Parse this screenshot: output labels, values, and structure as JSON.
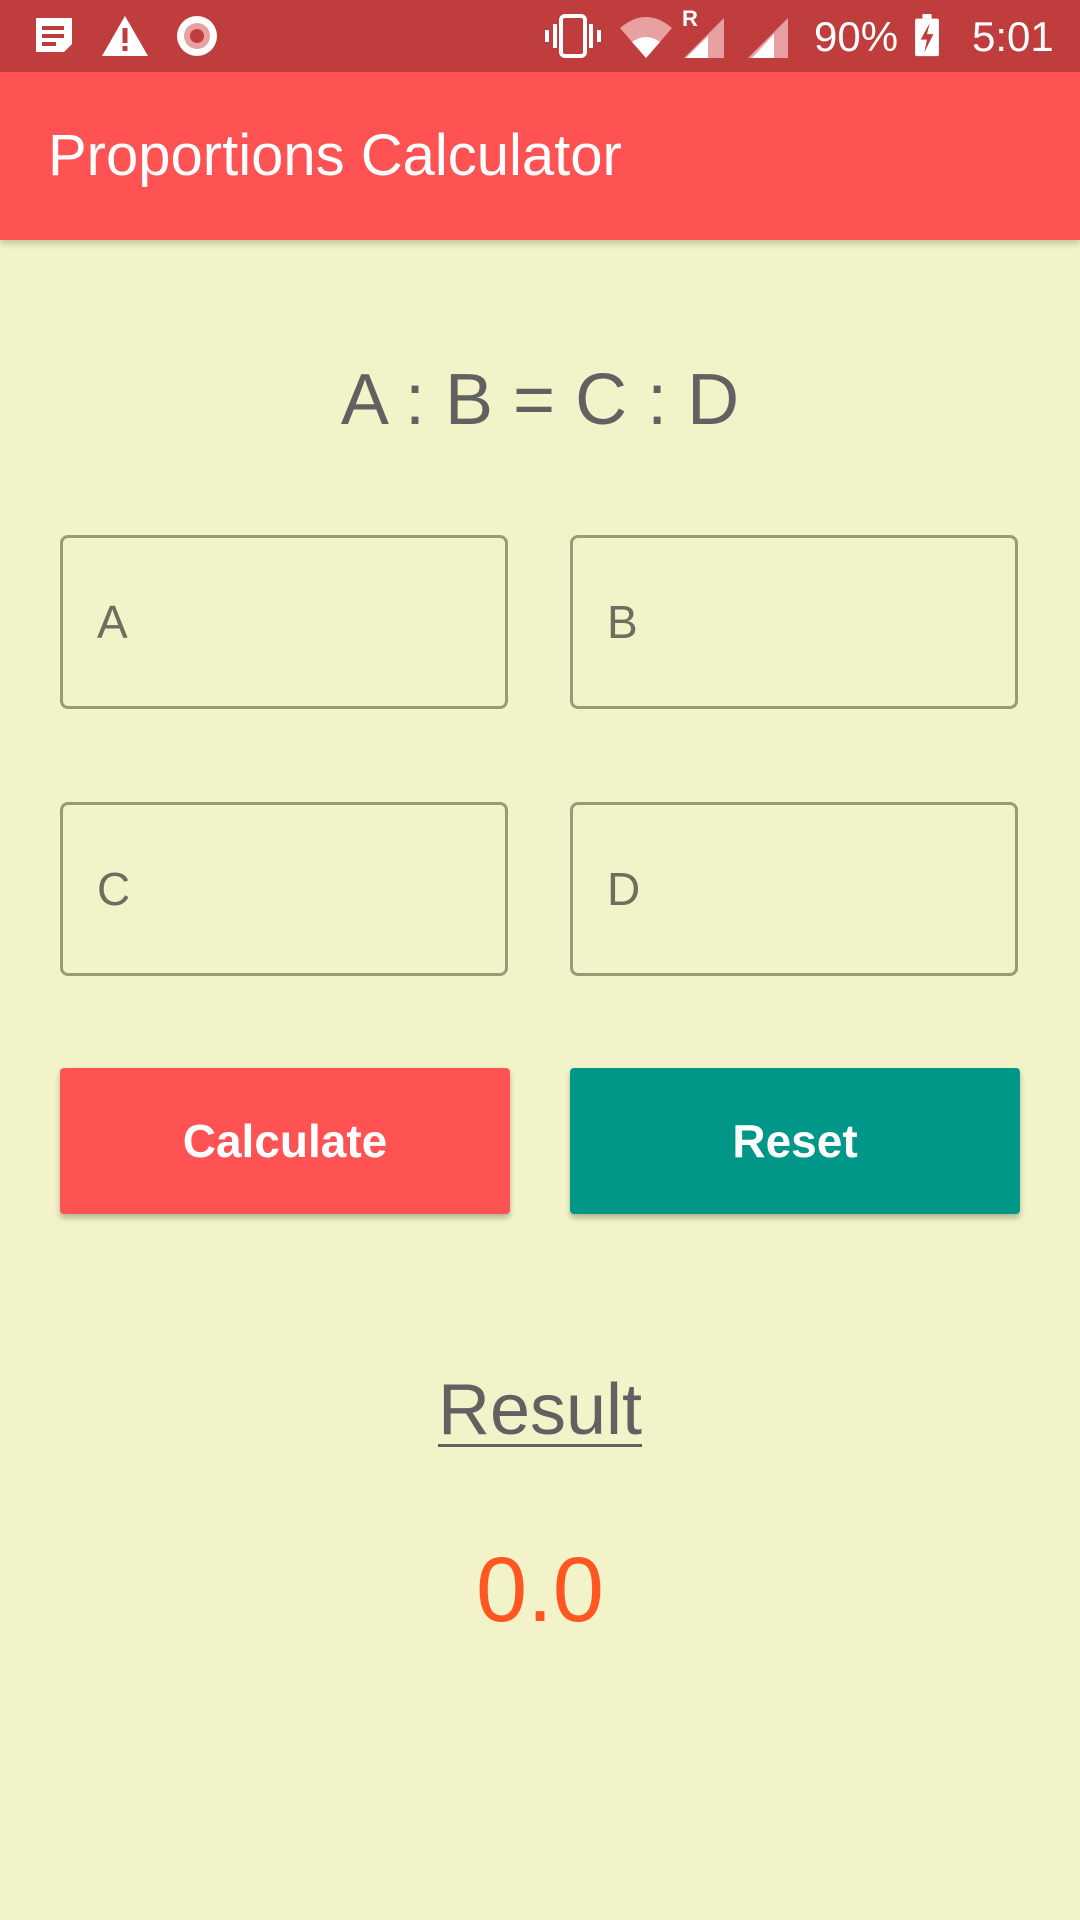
{
  "status_bar": {
    "battery": "90%",
    "time": "5:01",
    "roaming_indicator": "R",
    "icons": [
      "notification-icon",
      "warning-icon",
      "record-icon",
      "vibrate-icon",
      "wifi-icon",
      "signal-roaming-icon",
      "signal-icon",
      "battery-charging-icon"
    ]
  },
  "app_bar": {
    "title": "Proportions Calculator"
  },
  "formula": "A : B = C : D",
  "fields": {
    "a": {
      "placeholder": "A",
      "value": ""
    },
    "b": {
      "placeholder": "B",
      "value": ""
    },
    "c": {
      "placeholder": "C",
      "value": ""
    },
    "d": {
      "placeholder": "D",
      "value": ""
    }
  },
  "buttons": {
    "calculate": "Calculate",
    "reset": "Reset"
  },
  "result": {
    "label": "Result",
    "value": "0.0"
  },
  "colors": {
    "status_bar": "#c03d3d",
    "primary": "#ff5252",
    "accent": "#009688",
    "background": "#f2f3c8",
    "result_value": "#ff5722",
    "text_gray": "#616161"
  }
}
